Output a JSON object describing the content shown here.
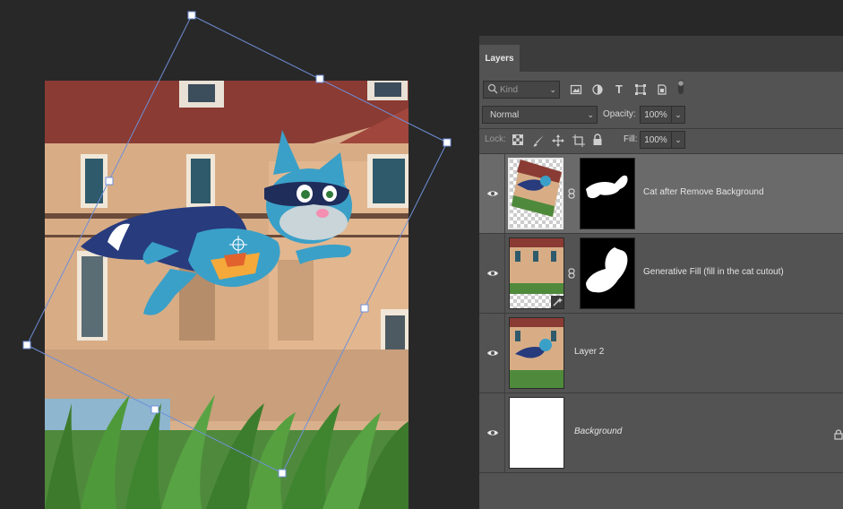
{
  "panel": {
    "tab_label": "Layers",
    "filter": {
      "kind_placeholder": "Kind",
      "filter_icons": [
        "image-filter-icon",
        "adjustment-filter-icon",
        "type-filter-icon",
        "shape-filter-icon",
        "smart-object-filter-icon",
        "filter-toggle-icon"
      ]
    },
    "blend_mode": "Normal",
    "opacity_label": "Opacity:",
    "opacity_value": "100%",
    "lock_label": "Lock:",
    "lock_icons": [
      "lock-transparent-icon",
      "lock-image-icon",
      "lock-position-icon",
      "lock-artboard-icon",
      "lock-all-icon"
    ],
    "fill_label": "Fill:",
    "fill_value": "100%"
  },
  "layers": [
    {
      "name": "Cat after Remove Background",
      "visible": true,
      "selected": true,
      "has_mask": true,
      "italic": false
    },
    {
      "name": "Generative Fill (fill in the cat cutout)",
      "visible": true,
      "selected": false,
      "has_mask": true,
      "italic": false
    },
    {
      "name": "Layer 2",
      "visible": true,
      "selected": false,
      "has_mask": false,
      "italic": false
    },
    {
      "name": "Background",
      "visible": true,
      "selected": false,
      "has_mask": false,
      "italic": true,
      "locked": true
    }
  ],
  "colors": {
    "app_bg": "#282828",
    "panel_bg": "#535353",
    "selected_row": "#6a6a6a",
    "transform_box": "#6f8fd8"
  }
}
